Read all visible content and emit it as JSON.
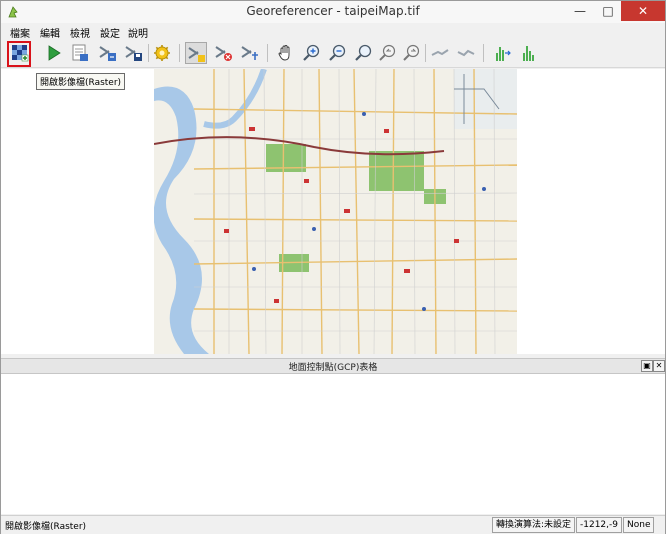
{
  "window": {
    "title": "Georeferencer - taipeiMap.tif",
    "controls": {
      "minimize": "—",
      "maximize": "□",
      "close": "✕"
    }
  },
  "menubar": {
    "items": [
      {
        "label": "檔案"
      },
      {
        "label": "編輯"
      },
      {
        "label": "檢視"
      },
      {
        "label": "設定"
      },
      {
        "label": "說明"
      }
    ]
  },
  "toolbar": {
    "buttons": [
      {
        "icon": "open-raster-icon",
        "active": true,
        "highlighted": true
      },
      {
        "icon": "start-georeferencing-icon"
      },
      {
        "icon": "generate-gdal-script-icon"
      },
      {
        "icon": "load-gcp-points-icon"
      },
      {
        "icon": "save-gcp-points-icon"
      },
      {
        "icon": "transformation-settings-icon"
      },
      {
        "icon": "add-point-icon",
        "pressed": true
      },
      {
        "icon": "delete-point-icon"
      },
      {
        "icon": "move-gcp-point-icon"
      },
      {
        "icon": "pan-icon"
      },
      {
        "icon": "zoom-in-icon"
      },
      {
        "icon": "zoom-out-icon"
      },
      {
        "icon": "zoom-to-layer-icon"
      },
      {
        "icon": "zoom-last-icon"
      },
      {
        "icon": "zoom-next-icon"
      },
      {
        "icon": "link-georeferencer-to-qgis-icon"
      },
      {
        "icon": "link-qgis-to-georeferencer-icon"
      },
      {
        "icon": "full-histogram-stretch-icon"
      },
      {
        "icon": "local-histogram-stretch-icon"
      }
    ],
    "tooltip": "開啟影像檔(Raster)"
  },
  "canvas": {
    "map_name": "taipeiMap.tif"
  },
  "gcp_dock": {
    "title": "地面控制點(GCP)表格",
    "float_button": "▣",
    "close_button": "✕"
  },
  "statusbar": {
    "message": "開啟影像檔(Raster)",
    "transform": "轉換演算法:未設定",
    "coordinates": "-1212,-9",
    "crs": "None"
  },
  "colors": {
    "highlight": "#d9121a",
    "close_button": "#c7372f",
    "map_paper": "#f2f0e8",
    "map_river": "#a8c8e8",
    "map_green": "#7dbb5a"
  }
}
